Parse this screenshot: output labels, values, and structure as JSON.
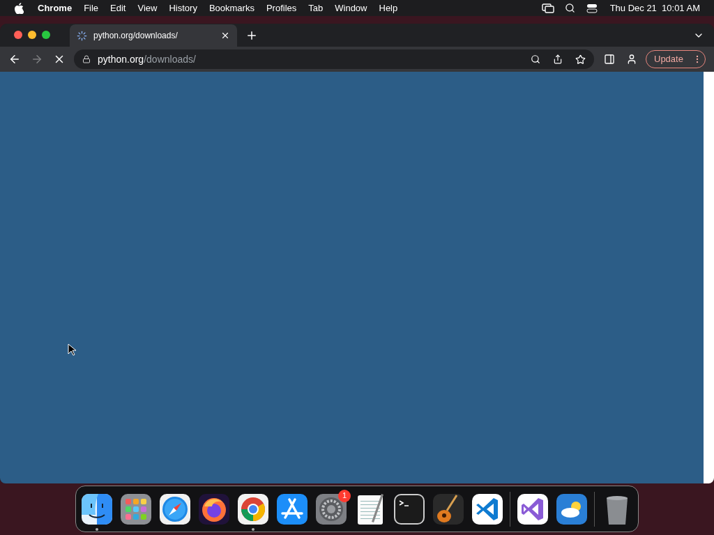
{
  "menubar": {
    "app_name": "Chrome",
    "menus": [
      "File",
      "Edit",
      "View",
      "History",
      "Bookmarks",
      "Profiles",
      "Tab",
      "Window",
      "Help"
    ],
    "clock": "Thu Dec 21  10:01 AM"
  },
  "tab": {
    "title": "python.org/downloads/",
    "loading": true
  },
  "address": {
    "host": "python.org",
    "path": "/downloads/"
  },
  "update_button": "Update",
  "dock": [
    {
      "kind": "finder",
      "running": true
    },
    {
      "kind": "launchpad",
      "running": false
    },
    {
      "kind": "safari",
      "running": false
    },
    {
      "kind": "firefox",
      "running": false
    },
    {
      "kind": "chrome",
      "running": true
    },
    {
      "kind": "appstore",
      "running": false
    },
    {
      "kind": "settings",
      "running": false,
      "badge": "1"
    },
    {
      "kind": "textedit",
      "running": false
    },
    {
      "kind": "terminal",
      "running": false
    },
    {
      "kind": "garageband",
      "running": false
    },
    {
      "kind": "vscode",
      "running": false
    },
    {
      "kind": "separator"
    },
    {
      "kind": "visualstudio",
      "running": false
    },
    {
      "kind": "weather",
      "running": false
    },
    {
      "kind": "separator"
    },
    {
      "kind": "trash",
      "running": false
    }
  ]
}
